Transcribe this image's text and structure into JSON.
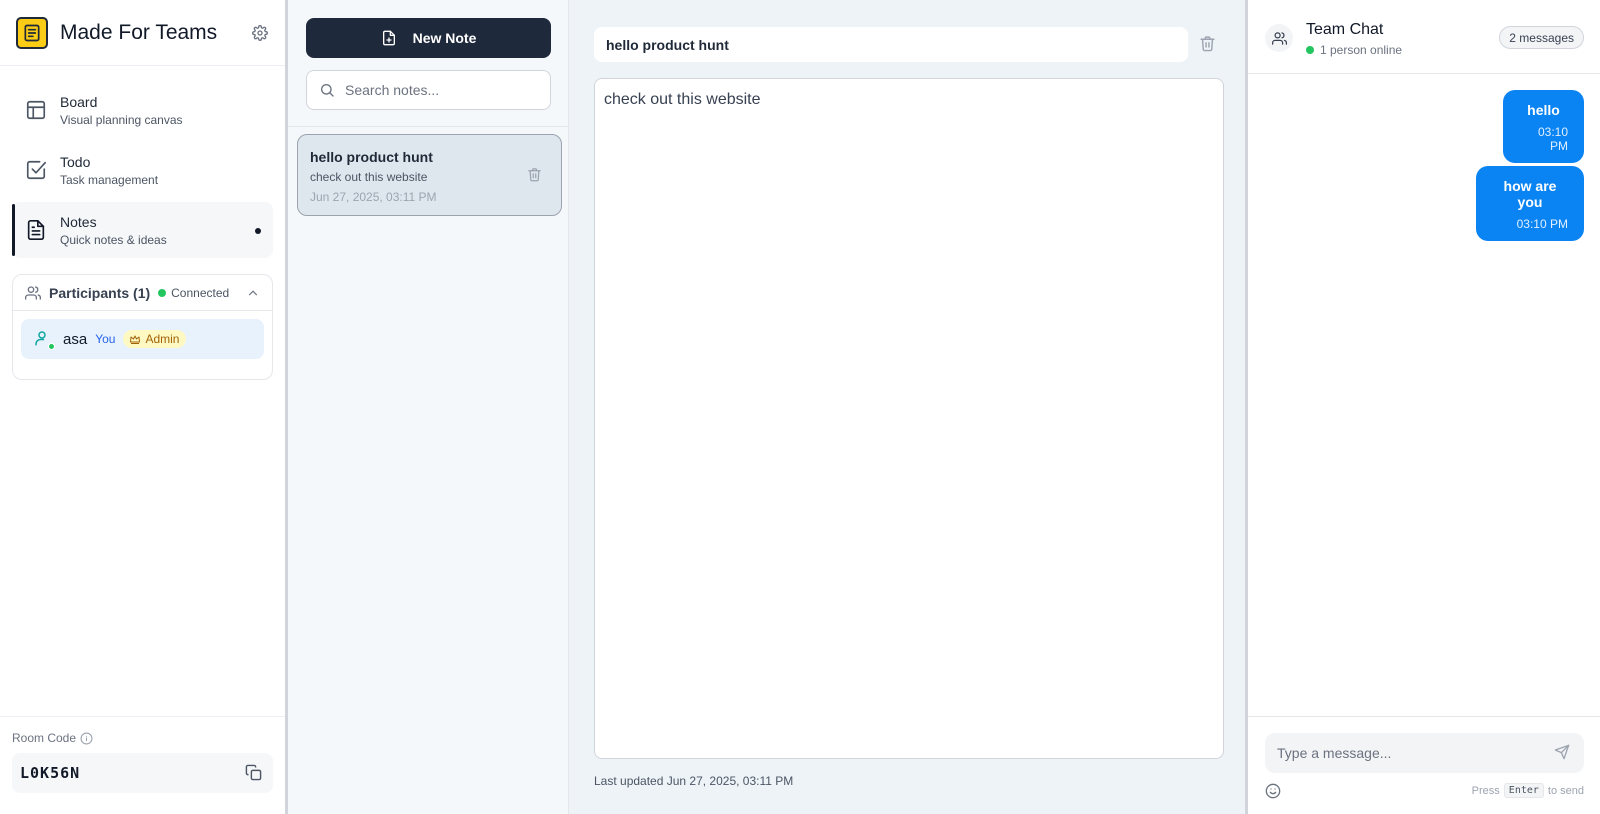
{
  "app": {
    "title": "Made For Teams"
  },
  "sidebar": {
    "items": [
      {
        "label": "Board",
        "sub": "Visual planning canvas",
        "icon": "layout-icon"
      },
      {
        "label": "Todo",
        "sub": "Task management",
        "icon": "check-square-icon"
      },
      {
        "label": "Notes",
        "sub": "Quick notes & ideas",
        "icon": "file-text-icon",
        "active": true
      }
    ]
  },
  "participants": {
    "title": "Participants (1)",
    "status": "Connected",
    "list": [
      {
        "name": "asa",
        "you_label": "You",
        "role": "Admin"
      }
    ]
  },
  "room": {
    "label": "Room Code",
    "code": "L0K56N"
  },
  "notes": {
    "new_label": "New Note",
    "search_placeholder": "Search notes...",
    "items": [
      {
        "title": "hello product hunt",
        "preview": "check out this website",
        "date": "Jun 27, 2025, 03:11 PM"
      }
    ]
  },
  "editor": {
    "title": "hello product hunt",
    "content": "check out this website",
    "last_updated": "Last updated Jun 27, 2025, 03:11 PM"
  },
  "chat": {
    "title": "Team Chat",
    "online": "1 person online",
    "count": "2 messages",
    "messages": [
      {
        "text": "hello",
        "time": "03:10 PM"
      },
      {
        "text": "how are you",
        "time": "03:10 PM"
      }
    ],
    "input_placeholder": "Type a message...",
    "hint_press": "Press",
    "hint_key": "Enter",
    "hint_action": "to send"
  },
  "colors": {
    "accent": "#0b84f3",
    "primary_button": "#1e293b",
    "logo": "#facc15",
    "online": "#22c55e",
    "admin_badge": "#fef9c3"
  }
}
